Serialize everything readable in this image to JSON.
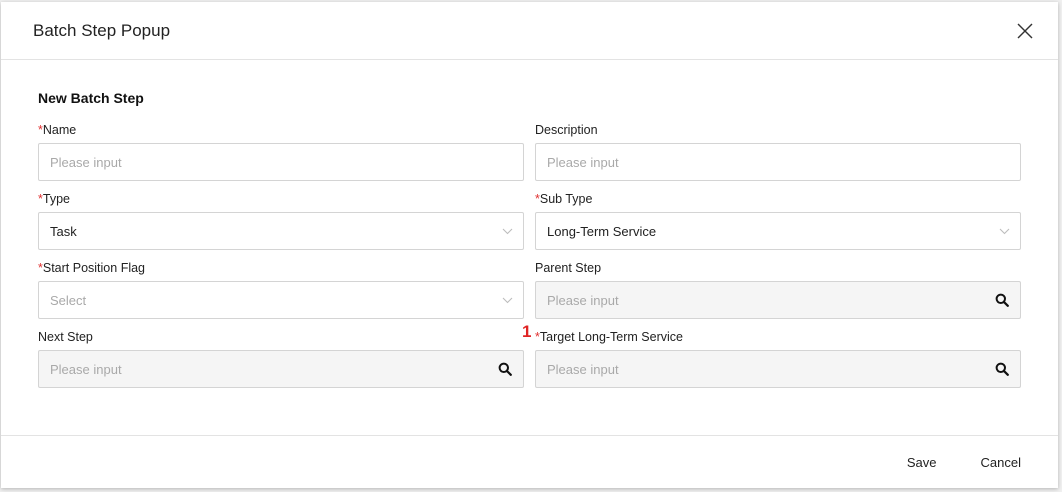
{
  "modal": {
    "title": "Batch Step Popup",
    "section_title": "New Batch Step"
  },
  "fields": {
    "name": {
      "label": "Name",
      "required_mark": "*",
      "placeholder": "Please input"
    },
    "description": {
      "label": "Description",
      "placeholder": "Please input"
    },
    "type": {
      "label": "Type",
      "required_mark": "*",
      "value": "Task"
    },
    "sub_type": {
      "label": "Sub Type",
      "required_mark": "*",
      "value": "Long-Term Service"
    },
    "start_position_flag": {
      "label": "Start Position Flag",
      "required_mark": "*",
      "placeholder": "Select"
    },
    "parent_step": {
      "label": "Parent Step",
      "placeholder": "Please input"
    },
    "next_step": {
      "label": "Next Step",
      "placeholder": "Please input"
    },
    "target_long_term_service": {
      "label": "Target Long-Term Service",
      "required_mark": "*",
      "placeholder": "Please input",
      "annotation": "1"
    }
  },
  "footer": {
    "save_label": "Save",
    "cancel_label": "Cancel"
  },
  "colors": {
    "required": "#e03030",
    "annotation": "#e02424",
    "disabled_bg": "#f5f5f5",
    "border": "#d4d4d4"
  },
  "icons": {
    "close": "close-icon",
    "dropdown": "chevron-down-icon",
    "search": "search-icon"
  }
}
